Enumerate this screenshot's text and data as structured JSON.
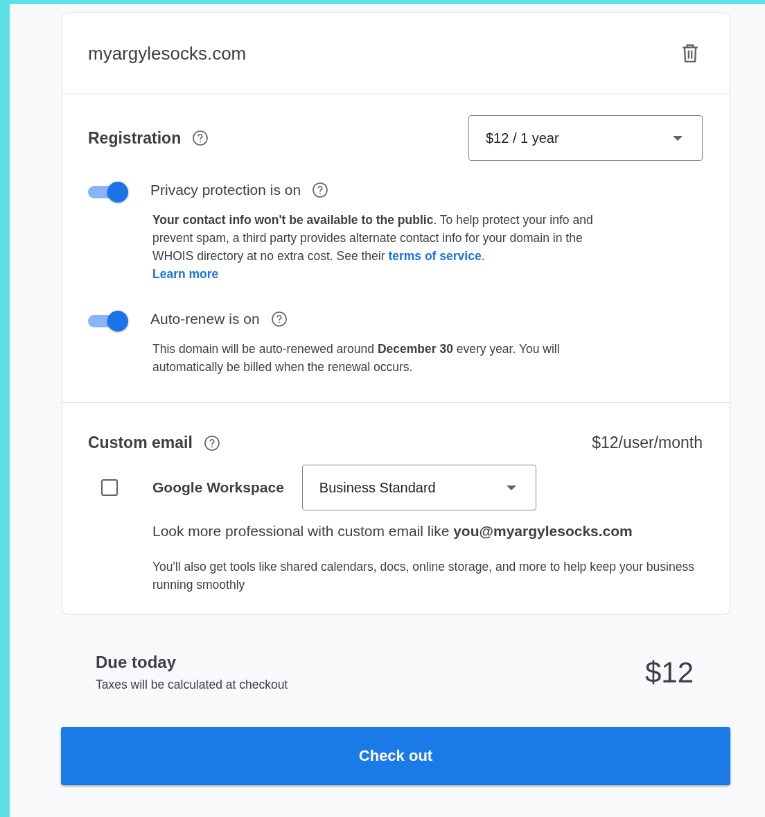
{
  "domain": {
    "name": "myargylesocks.com"
  },
  "registration": {
    "title": "Registration",
    "period": "$12 / 1 year",
    "options": [
      {
        "title": "Privacy protection is on",
        "on": true,
        "text": "**Your contact info won't be available to the public**. To help protect your info and prevent spam, a third party provides alternate contact info for your domain in the WHOIS directory at no extra cost. See their ",
        "link": "terms of service",
        "after": ".",
        "more": "Learn more"
      },
      {
        "title": "Auto-renew is on",
        "on": true,
        "text": "This domain will be auto-renewed around **December 30** every year. You will automatically be billed when the renewal occurs."
      }
    ]
  },
  "custom_email": {
    "title": "Custom email",
    "price": "$12/user/month",
    "checked": false,
    "product": "Google Workspace",
    "plan": "Business Standard",
    "pitch": "Look more professional with custom email like **you@myargylesocks.com**",
    "details": "You'll also get tools like shared calendars, docs, online storage, and more to help keep your business running smoothly"
  },
  "summary": {
    "title": "Due today",
    "note": "Taxes will be calculated at checkout",
    "total": "$12"
  },
  "checkout": "Check out"
}
